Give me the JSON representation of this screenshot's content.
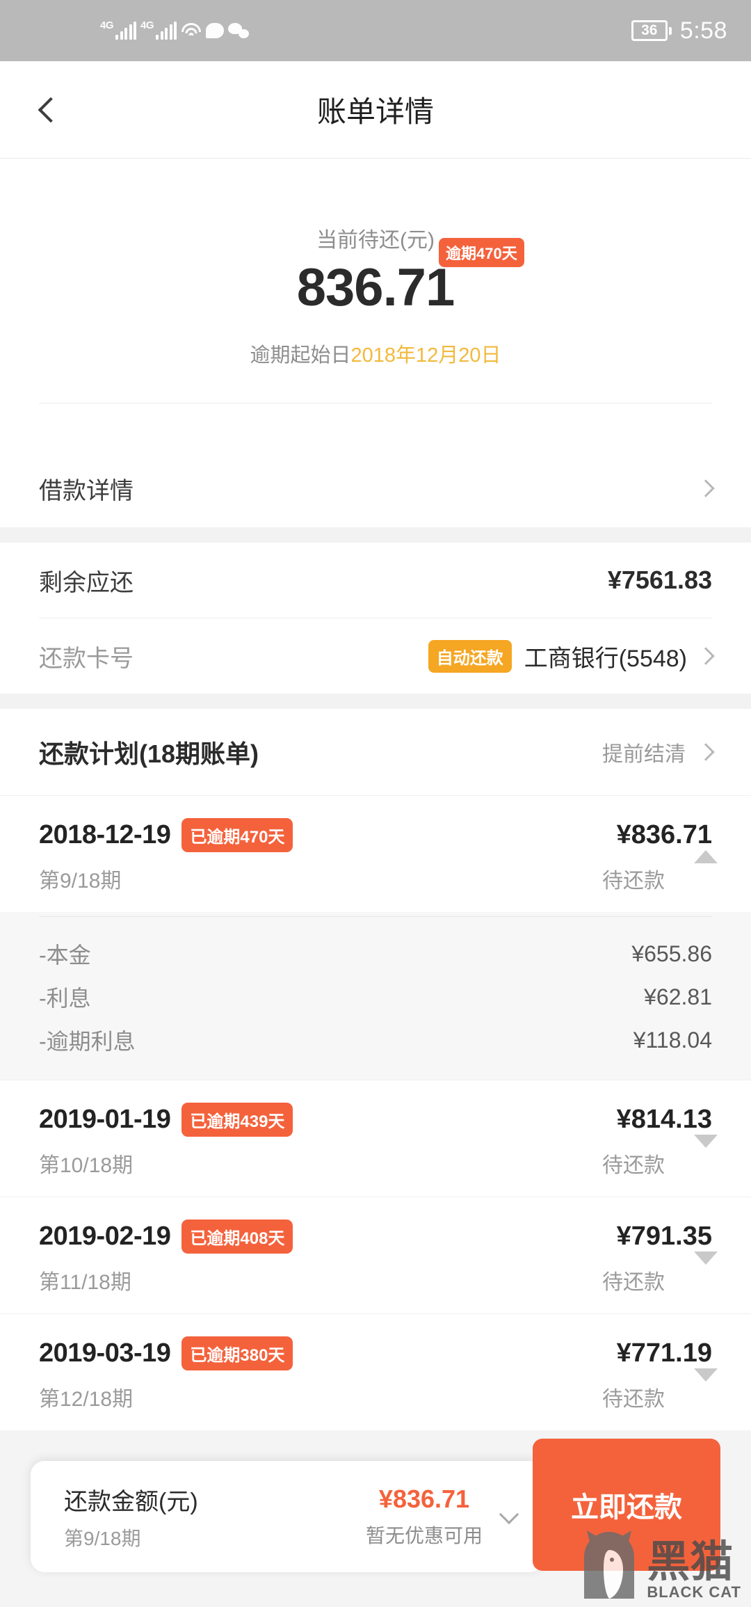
{
  "status_bar": {
    "network_label_1": "4G",
    "network_label_2": "4G",
    "battery": "36",
    "time": "5:58"
  },
  "header": {
    "title": "账单详情",
    "back_icon": "chevron-left-icon"
  },
  "summary": {
    "label": "当前待还(元)",
    "overdue_badge": "逾期470天",
    "amount": "836.71",
    "start_prefix": "逾期起始日",
    "start_date": "2018年12月20日"
  },
  "loan_detail_row": {
    "label": "借款详情"
  },
  "info": {
    "remaining_label": "剩余应还",
    "remaining_value": "¥7561.83",
    "card_label": "还款卡号",
    "auto_badge": "自动还款",
    "bank": "工商银行(5548)"
  },
  "plan": {
    "title": "还款计划(18期账单)",
    "action": "提前结清"
  },
  "installments": [
    {
      "date": "2018-12-19",
      "badge": "已逾期470天",
      "amount": "¥836.71",
      "term": "第9/18期",
      "status": "待还款",
      "expanded_icon": "triangle-up-icon",
      "breakdown": [
        {
          "label": "-本金",
          "value": "¥655.86"
        },
        {
          "label": "-利息",
          "value": "¥62.81"
        },
        {
          "label": "-逾期利息",
          "value": "¥118.04"
        }
      ]
    },
    {
      "date": "2019-01-19",
      "badge": "已逾期439天",
      "amount": "¥814.13",
      "term": "第10/18期",
      "status": "待还款",
      "expanded_icon": "triangle-down-icon"
    },
    {
      "date": "2019-02-19",
      "badge": "已逾期408天",
      "amount": "¥791.35",
      "term": "第11/18期",
      "status": "待还款",
      "expanded_icon": "triangle-down-icon"
    },
    {
      "date": "2019-03-19",
      "badge": "已逾期380天",
      "amount": "¥771.19",
      "term": "第12/18期",
      "status": "待还款",
      "expanded_icon": "triangle-down-icon"
    }
  ],
  "bottom_bar": {
    "amount_label": "还款金额(元)",
    "term": "第9/18期",
    "amount": "¥836.71",
    "coupon_text": "暂无优惠可用",
    "expand_icon": "chevron-down-icon",
    "pay_button": "立即还款"
  },
  "watermark": {
    "cn": "黑猫",
    "en": "BLACK CAT"
  },
  "colors": {
    "accent_orange": "#f4623c",
    "badge_yellow": "#f5a623",
    "date_gold": "#f2b93c"
  }
}
